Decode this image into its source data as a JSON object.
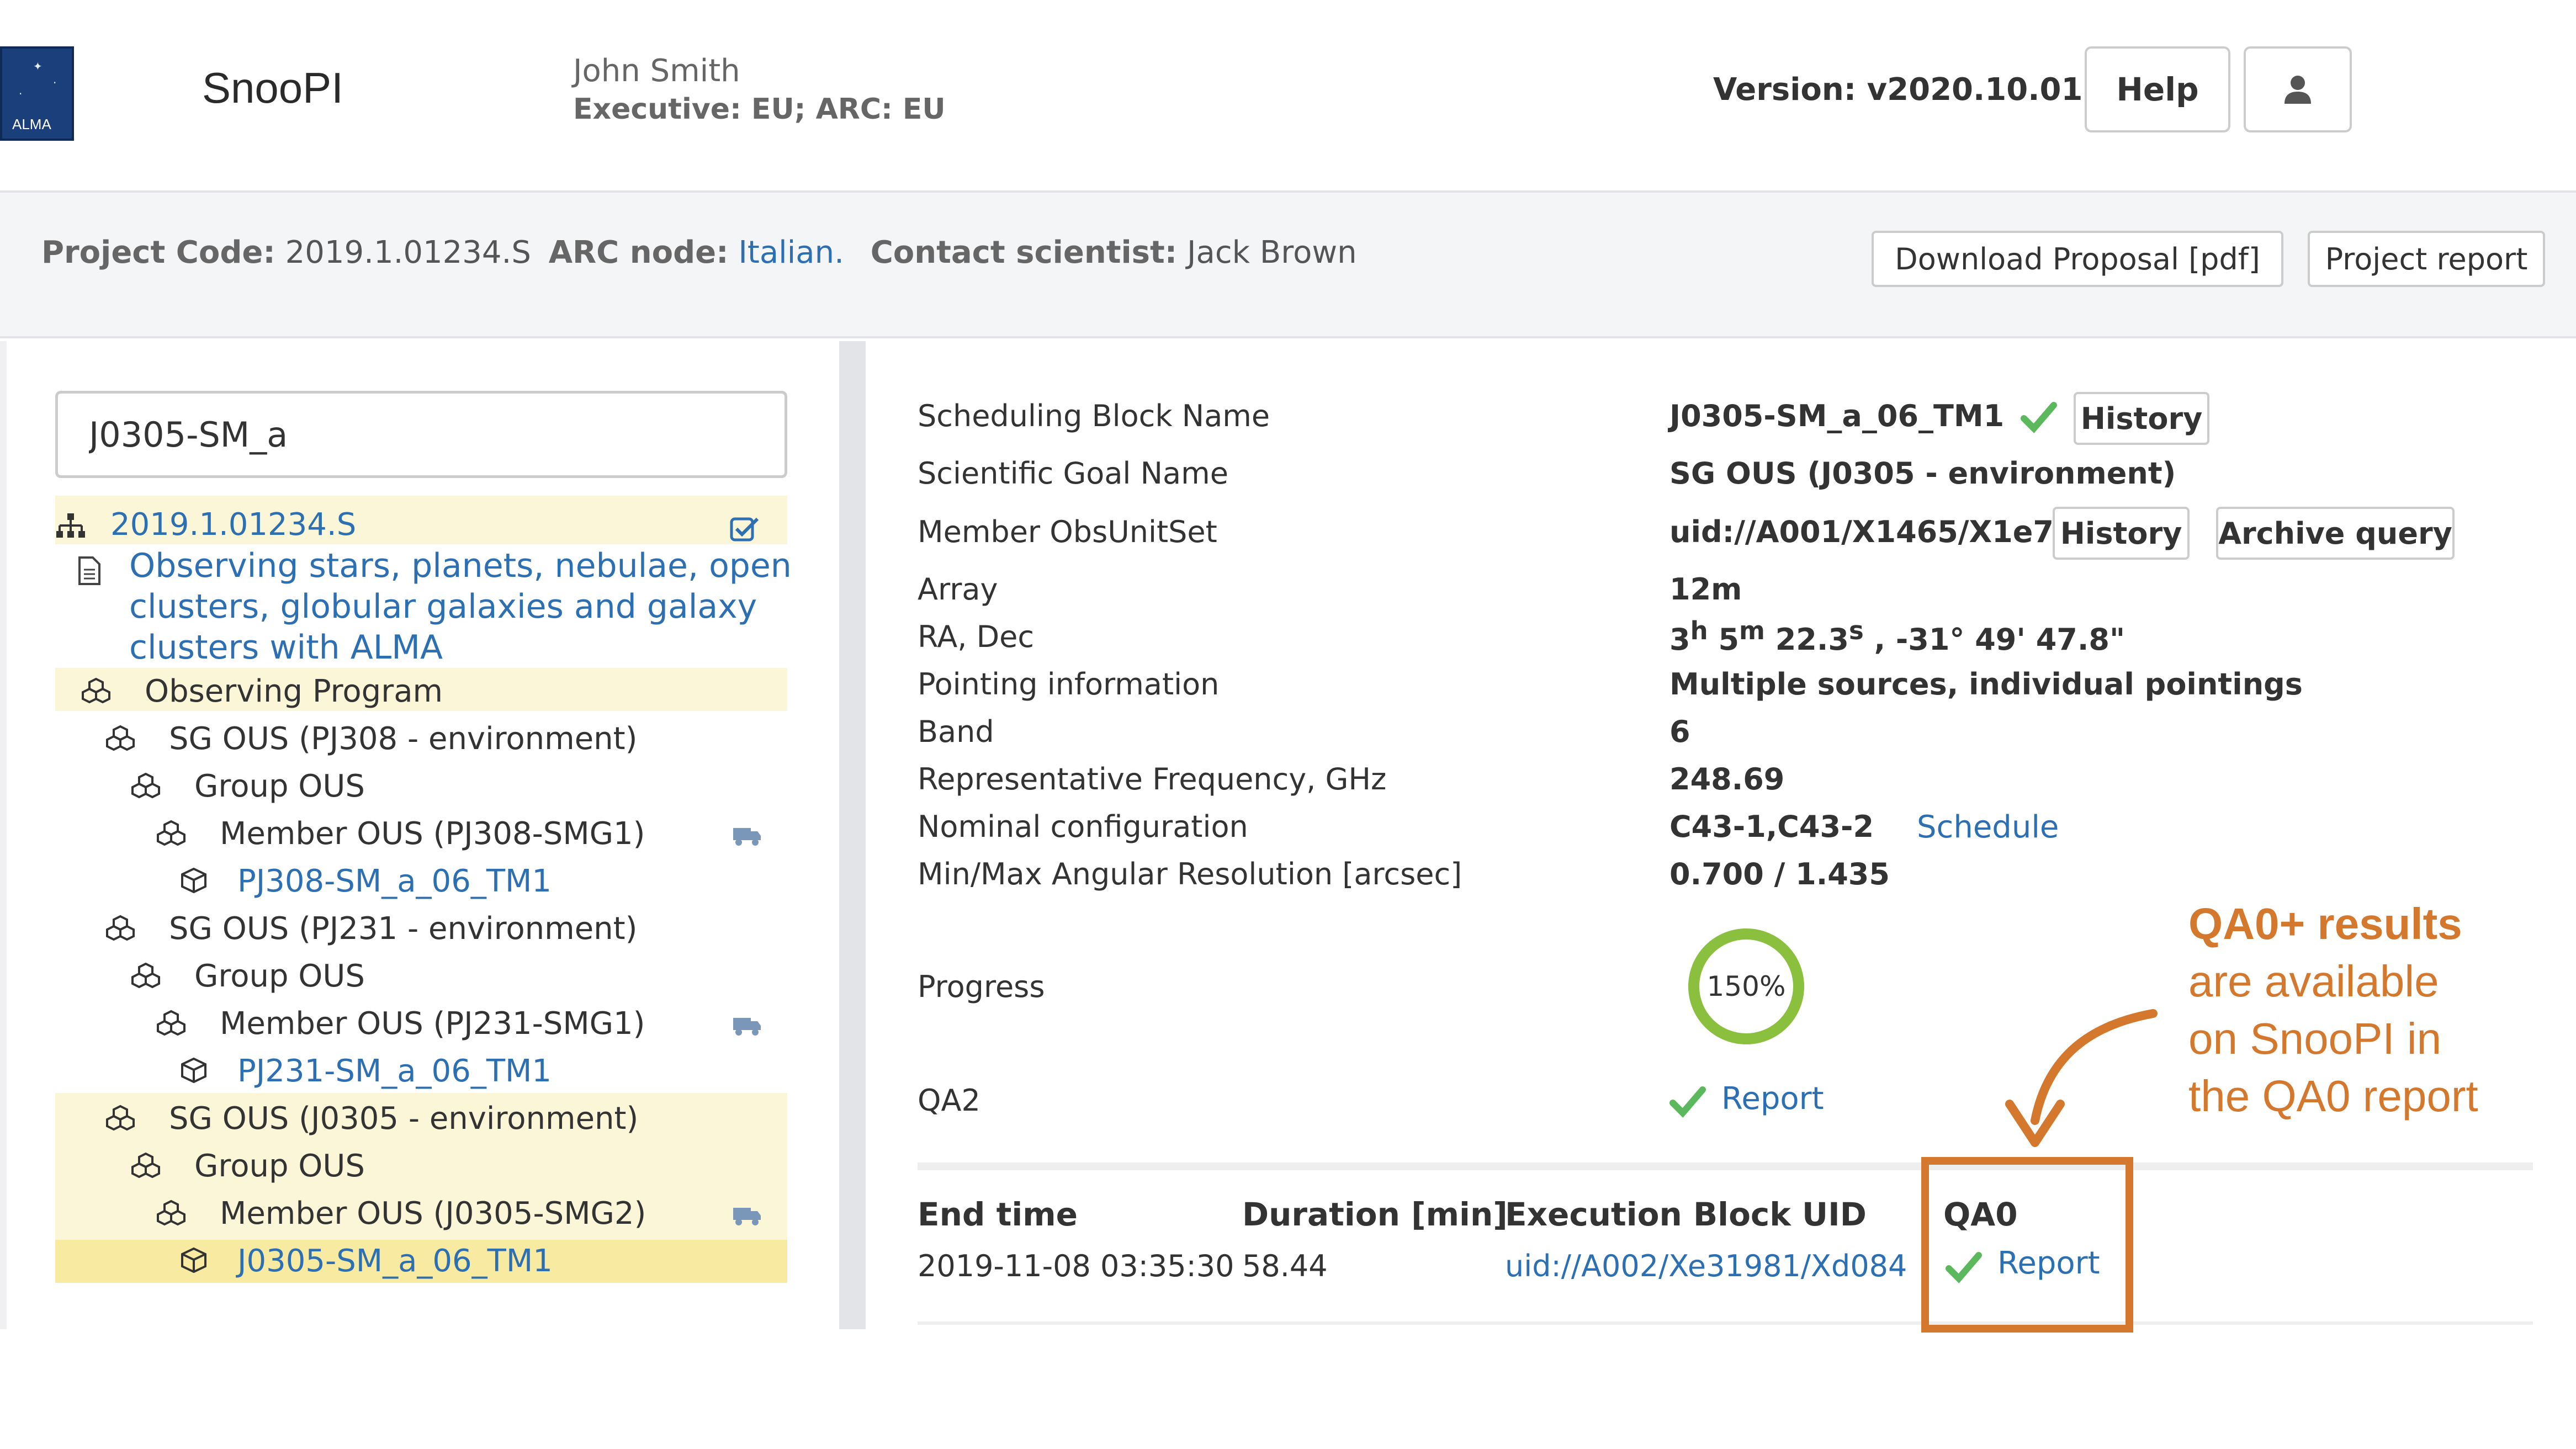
{
  "header": {
    "app_title": "SnooPI",
    "logo_text": "ALMA",
    "user_name": "John Smith",
    "user_role": "Executive: EU; ARC: EU",
    "version": "Version: v2020.10.01",
    "help_label": "Help",
    "user_icon": "user-icon"
  },
  "project": {
    "code_label": "Project Code:",
    "code_value": "2019.1.01234.S",
    "arc_label": "ARC node:",
    "arc_value": "Italian.",
    "contact_label": "Contact scientist:",
    "contact_value": "Jack Brown",
    "download_label": "Download Proposal [pdf]",
    "report_label": "Project report"
  },
  "sidebar": {
    "search_value": "J0305-SM_a",
    "tree": [
      {
        "label": "2019.1.01234.S",
        "icon": "sitemap-icon"
      },
      {
        "label": "Observing stars, planets, nebulae, open clusters, globular galaxies and galaxy clusters with ALMA",
        "lines": [
          "Observing stars, planets, nebulae, open",
          "clusters, globular galaxies and galaxy",
          "clusters with ALMA"
        ],
        "icon": "document-icon"
      },
      {
        "label": "Observing Program",
        "icon": "cubes-icon"
      },
      {
        "label": "SG OUS (PJ308 - environment)",
        "icon": "cubes-icon"
      },
      {
        "label": "Group OUS",
        "icon": "cubes-icon"
      },
      {
        "label": "Member OUS (PJ308-SMG1)",
        "icon": "cubes-icon"
      },
      {
        "label": "PJ308-SM_a_06_TM1",
        "icon": "cube-icon"
      },
      {
        "label": "SG OUS (PJ231 - environment)",
        "icon": "cubes-icon"
      },
      {
        "label": "Group OUS",
        "icon": "cubes-icon"
      },
      {
        "label": "Member OUS (PJ231-SMG1)",
        "icon": "cubes-icon"
      },
      {
        "label": "PJ231-SM_a_06_TM1",
        "icon": "cube-icon"
      },
      {
        "label": "SG OUS (J0305 - environment)",
        "icon": "cubes-icon"
      },
      {
        "label": "Group OUS",
        "icon": "cubes-icon"
      },
      {
        "label": "Member OUS (J0305-SMG2)",
        "icon": "cubes-icon"
      },
      {
        "label": "J0305-SM_a_06_TM1",
        "icon": "cube-icon"
      }
    ]
  },
  "details": {
    "rows": [
      {
        "label": "Scheduling Block Name",
        "value": "J0305-SM_a_06_TM1"
      },
      {
        "label": "Scientific Goal Name",
        "value": "SG OUS (J0305 - environment)"
      },
      {
        "label": "Member ObsUnitSet",
        "value": "uid://A001/X1465/X1e7a"
      },
      {
        "label": "Array",
        "value": "12m"
      },
      {
        "label": "RA, Dec",
        "value": "3h 5m 22.3s , -31° 49' 47.8\""
      },
      {
        "label": "Pointing information",
        "value": "Multiple sources, individual pointings"
      },
      {
        "label": "Band",
        "value": "6"
      },
      {
        "label": "Representative Frequency, GHz",
        "value": "248.69"
      },
      {
        "label": "Nominal configuration",
        "value": "C43-1,C43-2"
      },
      {
        "label": "Min/Max Angular Resolution [arcsec]",
        "value": "0.700 / 1.435"
      },
      {
        "label": "Progress",
        "value": "150%"
      },
      {
        "label": "QA2",
        "value": "Report"
      }
    ],
    "ra": {
      "h": "3",
      "h_sup": "h",
      "m": "5",
      "m_sup": "m",
      "s": "22.3",
      "s_sup": "s",
      "dec": ", -31° 49' 47.8\""
    },
    "history_label": "History",
    "archive_label": "Archive query",
    "schedule_label": "Schedule",
    "progress_fraction": 1.5
  },
  "exec_table": {
    "headers": [
      "End time",
      "Duration [min]",
      "Execution Block UID",
      "QA0"
    ],
    "rows": [
      {
        "end_time": "2019-11-08 03:35:30",
        "duration": "58.44",
        "uid": "uid://A002/Xe31981/Xd084",
        "qa0": "Report"
      }
    ]
  },
  "annotation": {
    "line1": "QA0+ results",
    "line2": "are available",
    "line3": "on SnooPI in",
    "line4": "the QA0 report",
    "color": "#d3782d"
  },
  "colors": {
    "link": "#2d6fb3",
    "check": "#5cb85c",
    "highlight": "#fbf6d7",
    "highlight_strong": "#f8eaa0"
  }
}
